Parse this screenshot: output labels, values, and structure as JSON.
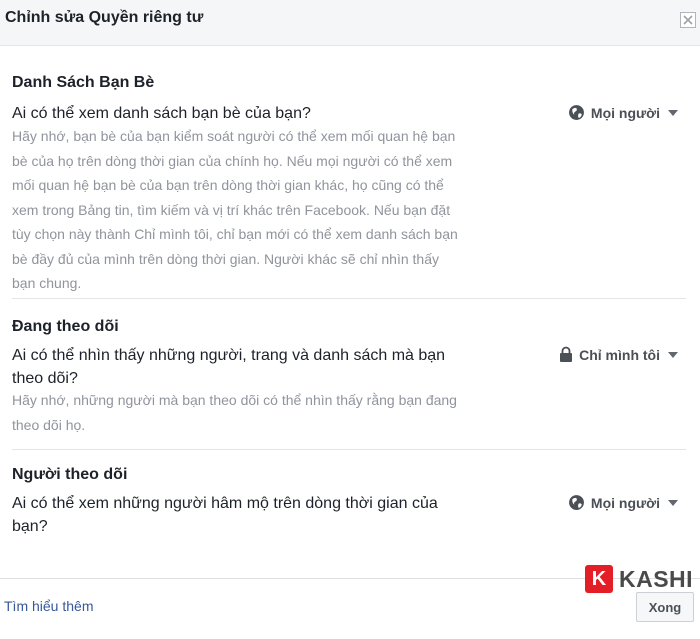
{
  "dialog": {
    "title": "Chỉnh sửa Quyền riêng tư",
    "close_icon": "close-icon"
  },
  "sections": [
    {
      "title": "Danh Sách Bạn Bè",
      "question": "Ai có thể xem danh sách bạn bè của bạn?",
      "description": "Hãy nhớ, bạn bè của bạn kiểm soát người có thể xem mối quan hệ bạn bè của họ trên dòng thời gian của chính họ. Nếu mọi người có thể xem mối quan hệ bạn bè của bạn trên dòng thời gian khác, họ cũng có thể xem trong Bảng tin, tìm kiếm và vị trí khác trên Facebook. Nếu bạn đặt tùy chọn này thành Chỉ mình tôi, chỉ bạn mới có thể xem danh sách bạn bè đầy đủ của mình trên dòng thời gian. Người khác sẽ chỉ nhìn thấy bạn chung.",
      "audience": "Mọi người",
      "audience_icon": "globe-icon"
    },
    {
      "title": "Đang theo dõi",
      "question": "Ai có thể nhìn thấy những người, trang và danh sách mà bạn theo dõi?",
      "description": "Hãy nhớ, những người mà bạn theo dõi có thể nhìn thấy rằng bạn đang theo dõi họ.",
      "audience": "Chỉ mình tôi",
      "audience_icon": "lock-icon"
    },
    {
      "title": "Người theo dõi",
      "question": "Ai có thể xem những người hâm mộ trên dòng thời gian của bạn?",
      "audience": "Mọi người",
      "audience_icon": "globe-icon"
    }
  ],
  "footer": {
    "learn_more": "Tìm hiểu thêm",
    "done": "Xong"
  },
  "watermark": {
    "letter": "K",
    "text": "KASHI"
  }
}
